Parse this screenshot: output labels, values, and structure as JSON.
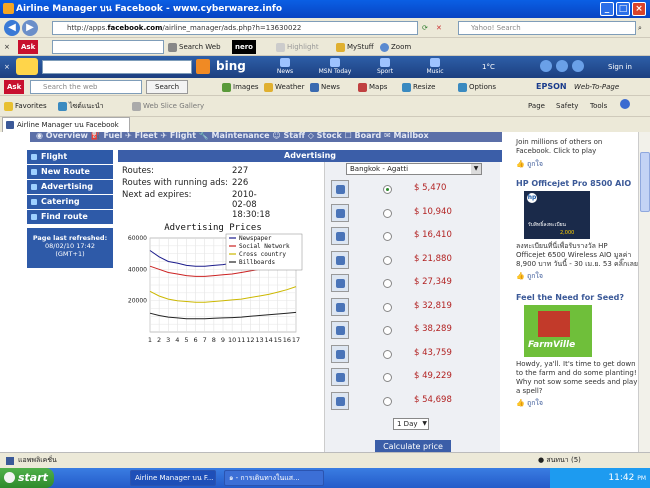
{
  "window": {
    "title": "Airline Manager บน Facebook - www.cyberwarez.info"
  },
  "nav": {
    "url_prefix": "http://apps.",
    "url_domain": "facebook.com",
    "url_suffix": "/airline_manager/ads.php?h=13630022",
    "search_placeholder": "Yahoo! Search"
  },
  "ask_toolbar": {
    "items": [
      "Search Web",
      "nero",
      "Highlight",
      "MyStuff",
      "Zoom"
    ]
  },
  "bing_bar": {
    "logo": "bing",
    "items": [
      "News",
      "MSN Today",
      "Sport",
      "Music"
    ],
    "temp": "1°C",
    "signin": "Sign in"
  },
  "toolbar3": {
    "search_placeholder": "Search the web",
    "search_btn": "Search",
    "items": [
      "Images",
      "Weather",
      "News",
      "Maps",
      "Resize",
      "Options"
    ],
    "epson": "EPSON",
    "web_to_page": "Web-To-Page"
  },
  "favorites": {
    "label": "Favorites",
    "items": [
      "ไซต์แนะนำ",
      "Web Slice Gallery"
    ],
    "right": [
      "Page",
      "Safety",
      "Tools"
    ]
  },
  "tab": {
    "title": "Airline Manager บน Facebook"
  },
  "fb_menu": "◉ Overview  ⛽ Fuel  ✈ Fleet  ✈ Flight  🔧 Maintenance  ☺ Staff  ◇ Stock  ☐ Board  ✉ Mailbox",
  "leftnav": {
    "items": [
      "Flight",
      "New Route",
      "Advertising",
      "Catering",
      "Find route"
    ],
    "refresh_label": "Page last refreshed:",
    "refresh_time": "08/02/10 17:42",
    "refresh_tz": "(GMT+1)"
  },
  "advertising": {
    "header": "Advertising",
    "routes_label": "Routes:",
    "routes_value": "227",
    "running_label": "Routes with running ads:",
    "running_value": "226",
    "expires_label": "Next ad expires:",
    "expires_value": "2010-02-08 18:30:18"
  },
  "chart_data": {
    "type": "line",
    "title": "Advertising Prices",
    "x": [
      1,
      2,
      3,
      4,
      5,
      6,
      7,
      8,
      9,
      10,
      11,
      12,
      13,
      14,
      15,
      16,
      17
    ],
    "ylim": [
      0,
      60000
    ],
    "yticks": [
      20000,
      40000,
      60000
    ],
    "legend_position": "top-right",
    "series": [
      {
        "name": "Newspaper",
        "color": "#1c1c8c",
        "values": [
          52000,
          48000,
          45000,
          44000,
          42500,
          42000,
          42000,
          42500,
          43000,
          44000,
          45000,
          46000,
          47500,
          49000,
          51000,
          53000,
          55000
        ]
      },
      {
        "name": "Social Network",
        "color": "#cc2222",
        "values": [
          42000,
          40000,
          38000,
          37000,
          36000,
          35500,
          35500,
          36000,
          36500,
          37000,
          38000,
          39000,
          40000,
          41500,
          43000,
          45000,
          47000
        ]
      },
      {
        "name": "Cross country",
        "color": "#ccb800",
        "values": [
          26000,
          23000,
          21000,
          20000,
          19500,
          19000,
          19000,
          19500,
          20000,
          20500,
          21000,
          22000,
          23000,
          24000,
          25500,
          27000,
          29000
        ]
      },
      {
        "name": "Billboards",
        "color": "#222222",
        "values": [
          12000,
          10500,
          9500,
          9000,
          8500,
          8500,
          8500,
          8800,
          9000,
          9200,
          9500,
          10000,
          10500,
          11000,
          11500,
          12000,
          12500
        ]
      }
    ]
  },
  "prices": {
    "city": "Bangkok - Agatti",
    "options": [
      "$ 5,470",
      "$ 10,940",
      "$ 16,410",
      "$ 21,880",
      "$ 27,349",
      "$ 32,819",
      "$ 38,289",
      "$ 43,759",
      "$ 49,229",
      "$ 54,698"
    ],
    "selected_index": 0,
    "duration": "1 Day",
    "calc_btn": "Calculate price"
  },
  "ads": {
    "top_text": "Join millions of others on Facebook. Click to play",
    "like1": "ถูกใจ",
    "hp_title": "HP Officejet Pro 8500 AIO",
    "hp_img_text": "รับสิทธิ์ลงทะเบียน",
    "hp_img_price": "2,000",
    "hp_body": "ลงทะเบียนที่นี่เพื่อรับรางวัล HP Officejet 6500 Wireless AIO มูลค่า 8,900 บาท วันนี้ - 30 เม.ย. 53 คลิ๊กเลย",
    "like2": "ถูกใจ",
    "farm_title": "Feel the Need for Seed?",
    "farm_logo": "FarmVille",
    "farm_body": "Howdy, ya'll. It's time to get down to the farm and do some planting! Why not sow some seeds and play a spell?",
    "like3": "ถูกใจ"
  },
  "status": {
    "left": "แอพพลิเคชั่น",
    "chat": "สนทนา (5)"
  },
  "taskbar": {
    "start": "start",
    "tasks": [
      "Airline Manager บน F...",
      "๑ - การเดินทางในแส..."
    ],
    "time": "11:42",
    "ampm": "PM"
  }
}
